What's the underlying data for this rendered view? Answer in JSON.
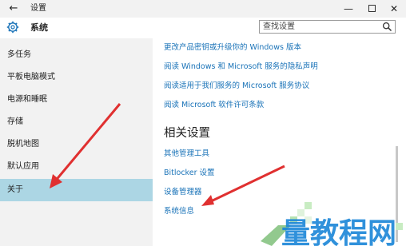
{
  "window": {
    "title": "设置",
    "back_glyph": "←",
    "minimize_glyph": "—",
    "close_glyph": "✕"
  },
  "header": {
    "section_title": "系统",
    "search_placeholder": "查找设置"
  },
  "sidebar": {
    "items": [
      {
        "label": "多任务",
        "active": false
      },
      {
        "label": "平板电脑模式",
        "active": false
      },
      {
        "label": "电源和睡眠",
        "active": false
      },
      {
        "label": "存储",
        "active": false
      },
      {
        "label": "脱机地图",
        "active": false
      },
      {
        "label": "默认应用",
        "active": false
      },
      {
        "label": "关于",
        "active": true
      }
    ]
  },
  "main": {
    "top_links": [
      "更改产品密钥或升级你的 Windows 版本",
      "阅读 Windows 和 Microsoft 服务的隐私声明",
      "阅读适用于我们服务的 Microsoft 服务协议",
      "阅读 Microsoft 软件许可条款"
    ],
    "related_heading": "相关设置",
    "related_links": [
      "其他管理工具",
      "Bitlocker 设置",
      "设备管理器",
      "系统信息"
    ]
  },
  "watermark": {
    "text": "量教程网"
  },
  "colors": {
    "accent": "#1a73b8",
    "active_item": "#acd6e4",
    "sidebar_bg": "#f2f2f2",
    "arrow": "#e03030"
  },
  "icons": [
    "back-arrow-icon",
    "gear-icon",
    "search-icon",
    "minimize-icon",
    "maximize-icon",
    "close-icon"
  ]
}
